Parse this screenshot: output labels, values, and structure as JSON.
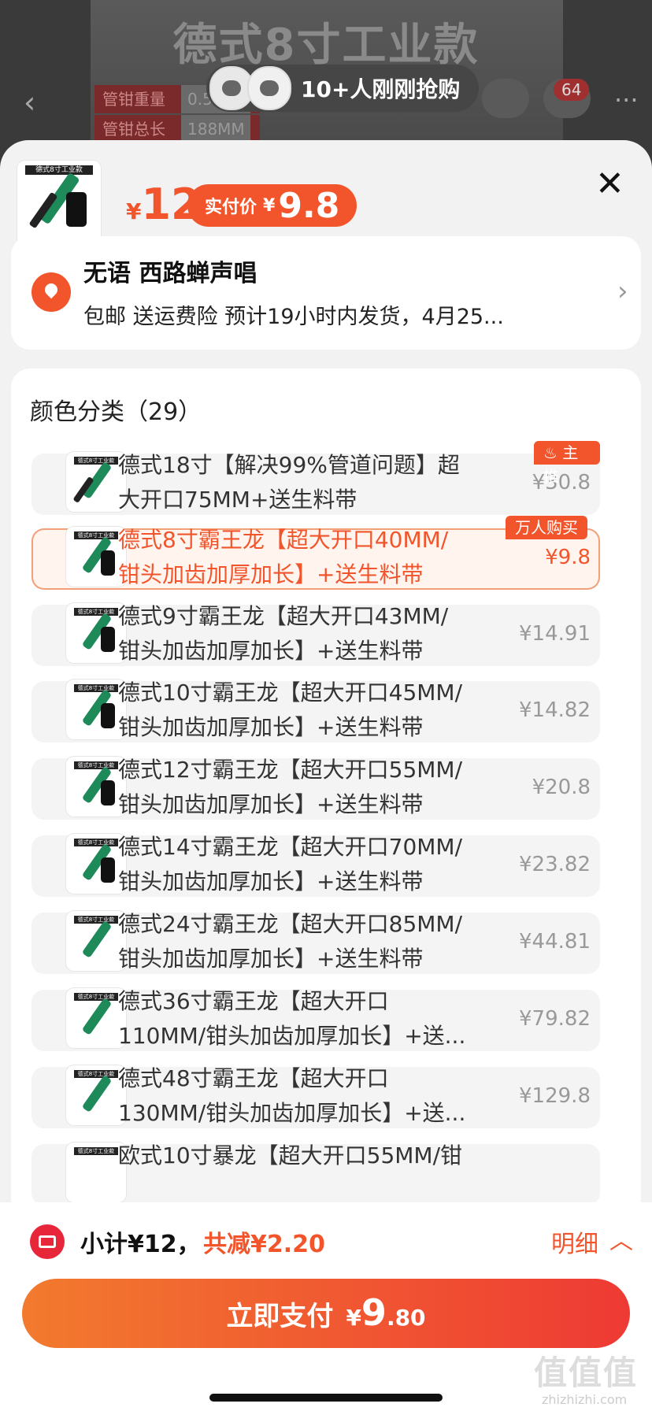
{
  "background": {
    "title": "德式8寸工业款",
    "specs": [
      {
        "label": "管钳重量",
        "value": "0.5"
      },
      {
        "label": "管钳总长",
        "value": "188MM"
      }
    ],
    "cart_count": "64",
    "toast": "10+人刚刚抢购"
  },
  "header": {
    "price_symbol": "¥",
    "price": "12",
    "pay_label": "实付价",
    "pay_symbol": "¥",
    "pay_price": "9.8"
  },
  "address": {
    "name_line": "无语 西路蝉声唱",
    "shipping": "包邮 送运费险 预计19小时内发货，4月25..."
  },
  "spec": {
    "title": "颜色分类（29）",
    "options": [
      {
        "name": "德式18寸【解决99%管道问题】超大开口75MM+送生料带",
        "line1": "德式18寸【解决99%管道问题】超",
        "line2": "大开口75MM+送生料带",
        "price": "¥30.8",
        "tag": "主推"
      },
      {
        "name": "德式8寸霸王龙【超大开口40MM/钳头加齿加厚加长】+送生料带",
        "line1": "德式8寸霸王龙【超大开口40MM/",
        "line2": "钳头加齿加厚加长】+送生料带",
        "price": "¥9.8",
        "tag": "万人购买"
      },
      {
        "line1": "德式9寸霸王龙【超大开口43MM/",
        "line2": "钳头加齿加厚加长】+送生料带",
        "price": "¥14.91"
      },
      {
        "line1": "德式10寸霸王龙【超大开口45MM/",
        "line2": "钳头加齿加厚加长】+送生料带",
        "price": "¥14.82"
      },
      {
        "line1": "德式12寸霸王龙【超大开口55MM/",
        "line2": "钳头加齿加厚加长】+送生料带",
        "price": "¥20.8"
      },
      {
        "line1": "德式14寸霸王龙【超大开口70MM/",
        "line2": "钳头加齿加厚加长】+送生料带",
        "price": "¥23.82"
      },
      {
        "line1": "德式24寸霸王龙【超大开口85MM/",
        "line2": "钳头加齿加厚加长】+送生料带",
        "price": "¥44.81"
      },
      {
        "line1": "德式36寸霸王龙【超大开口",
        "line2": "110MM/钳头加齿加厚加长】+送...",
        "price": "¥79.82"
      },
      {
        "line1": "德式48寸霸王龙【超大开口",
        "line2": "130MM/钳头加齿加厚加长】+送...",
        "price": "¥129.8"
      },
      {
        "line1": "欧式10寸暴龙【超大开口55MM/钳",
        "line2": "",
        "price": ""
      }
    ]
  },
  "footer": {
    "subtotal": "小计¥12，",
    "discount": "共减¥2.20",
    "detail": "明细",
    "pay_label": "立即支付",
    "pay_symbol": "¥",
    "pay_int": "9",
    "pay_dec": ".80"
  },
  "watermark": {
    "text": "值值值",
    "site": "zhizhizhi.com"
  },
  "colors": {
    "accent": "#f2552c",
    "coupon": "#e8263a"
  }
}
